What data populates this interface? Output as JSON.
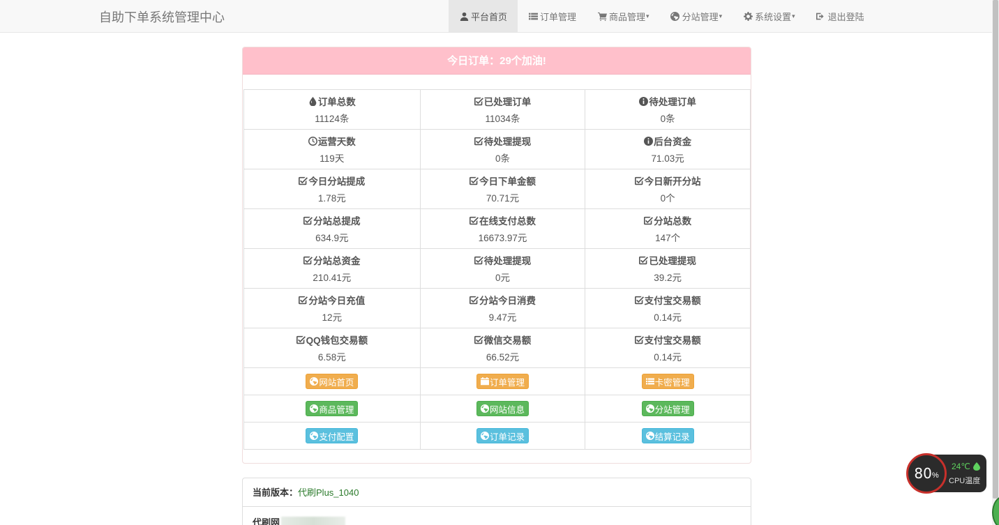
{
  "navbar": {
    "brand": "自助下单系统管理中心",
    "items": [
      {
        "label": "平台首页",
        "icon": "user-icon",
        "active": true,
        "dropdown": false
      },
      {
        "label": "订单管理",
        "icon": "list-icon",
        "active": false,
        "dropdown": false
      },
      {
        "label": "商品管理",
        "icon": "cart-icon",
        "active": false,
        "dropdown": true
      },
      {
        "label": "分站管理",
        "icon": "globe-icon",
        "active": false,
        "dropdown": true
      },
      {
        "label": "系统设置",
        "icon": "gear-icon",
        "active": false,
        "dropdown": true
      },
      {
        "label": "退出登陆",
        "icon": "logout-icon",
        "active": false,
        "dropdown": false
      }
    ],
    "caret": "▾"
  },
  "panel": {
    "heading": "今日订单：29个加油!",
    "stats": [
      [
        {
          "label": "订单总数",
          "value": "11124条",
          "icon": "tint-icon"
        },
        {
          "label": "已处理订单",
          "value": "11034条",
          "icon": "check-square-icon"
        },
        {
          "label": "待处理订单",
          "value": "0条",
          "icon": "info-circle-icon"
        }
      ],
      [
        {
          "label": "运营天数",
          "value": "119天",
          "icon": "clock-icon"
        },
        {
          "label": "待处理提现",
          "value": "0条",
          "icon": "check-square-icon"
        },
        {
          "label": "后台资金",
          "value": "71.03元",
          "icon": "info-circle-icon"
        }
      ],
      [
        {
          "label": "今日分站提成",
          "value": "1.78元",
          "icon": "check-square-icon"
        },
        {
          "label": "今日下单金额",
          "value": "70.71元",
          "icon": "check-square-icon"
        },
        {
          "label": "今日新开分站",
          "value": "0个",
          "icon": "check-square-icon"
        }
      ],
      [
        {
          "label": "分站总提成",
          "value": "634.9元",
          "icon": "check-square-icon"
        },
        {
          "label": "在线支付总数",
          "value": "16673.97元",
          "icon": "check-square-icon"
        },
        {
          "label": "分站总数",
          "value": "147个",
          "icon": "check-square-icon"
        }
      ],
      [
        {
          "label": "分站总资金",
          "value": "210.41元",
          "icon": "check-square-icon"
        },
        {
          "label": "待处理提现",
          "value": "0元",
          "icon": "check-square-icon"
        },
        {
          "label": "已处理提现",
          "value": "39.2元",
          "icon": "check-square-icon"
        }
      ],
      [
        {
          "label": "分站今日充值",
          "value": "12元",
          "icon": "check-square-icon"
        },
        {
          "label": "分站今日消费",
          "value": "9.47元",
          "icon": "check-square-icon"
        },
        {
          "label": "支付宝交易额",
          "value": "0.14元",
          "icon": "check-square-icon"
        }
      ],
      [
        {
          "label": "QQ钱包交易额",
          "value": "6.58元",
          "icon": "check-square-icon"
        },
        {
          "label": "微信交易额",
          "value": "66.52元",
          "icon": "check-square-icon"
        },
        {
          "label": "支付宝交易额",
          "value": "0.14元",
          "icon": "check-square-icon"
        }
      ]
    ],
    "buttons": [
      [
        {
          "label": "网站首页",
          "style": "warning",
          "icon": "globe-icon"
        },
        {
          "label": "订单管理",
          "style": "warning",
          "icon": "calendar-icon"
        },
        {
          "label": "卡密管理",
          "style": "warning",
          "icon": "list-icon"
        }
      ],
      [
        {
          "label": "商品管理",
          "style": "success",
          "icon": "globe-icon"
        },
        {
          "label": "网站信息",
          "style": "success",
          "icon": "globe-icon"
        },
        {
          "label": "分站管理",
          "style": "success",
          "icon": "globe-icon"
        }
      ],
      [
        {
          "label": "支付配置",
          "style": "info",
          "icon": "globe-icon"
        },
        {
          "label": "订单记录",
          "style": "info",
          "icon": "globe-icon"
        },
        {
          "label": "结算记录",
          "style": "info",
          "icon": "globe-icon"
        }
      ]
    ]
  },
  "version": {
    "label": "当前版本：",
    "value": "代刷Plus_1040",
    "site_label": "代刷网"
  },
  "cpu_widget": {
    "usage": "80",
    "usage_unit": "%",
    "temperature": "24℃",
    "label": "CPU温度"
  },
  "colors": {
    "heading_bg": "#ffc0cb",
    "warning": "#f0ad4e",
    "success": "#5cb85c",
    "info": "#5bc0de",
    "version_value": "#2a7a2a"
  }
}
